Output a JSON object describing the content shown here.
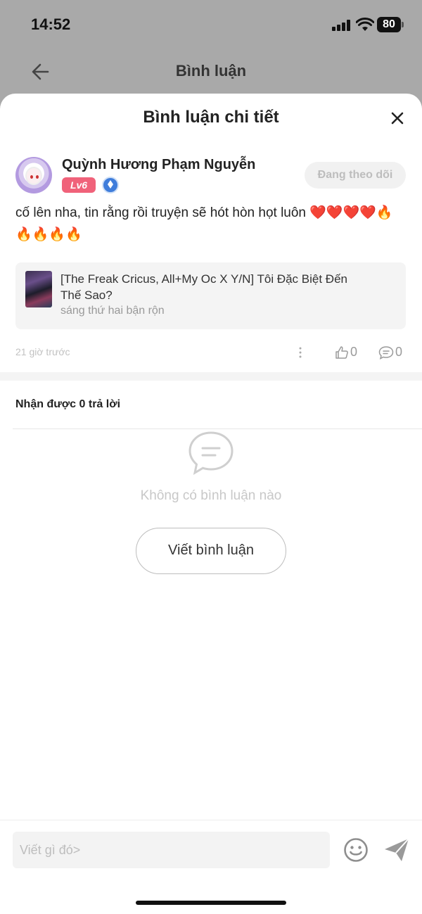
{
  "status_bar": {
    "time": "14:52",
    "battery": "80"
  },
  "nav": {
    "title": "Bình luận"
  },
  "sheet": {
    "title": "Bình luận chi tiết"
  },
  "comment": {
    "username": "Quỳnh Hương Phạm Nguyễn",
    "level": "Lv6",
    "follow_label": "Đang theo dõi",
    "text": "cố lên nha, tin rằng rồi truyện sẽ hót hòn họt luôn ❤️❤️❤️❤️🔥🔥🔥🔥🔥",
    "story_title": "[The Freak Cricus, All+My Oc X Y/N] Tôi Đặc Biệt Đến Thế Sao?",
    "story_chapter": "sáng thứ hai bận rộn",
    "time": "21 giờ trước",
    "likes": "0",
    "replies": "0"
  },
  "replies_section": {
    "label": "Nhận được 0 trả lời",
    "empty_text": "Không có bình luận nào",
    "write_button": "Viết bình luận"
  },
  "input": {
    "placeholder": "Viết gì đó>"
  },
  "colors": {
    "level_badge": "#f0627a",
    "rank_badge": "#3f7ddb"
  },
  "icons": [
    "back-arrow-icon",
    "close-icon",
    "more-icon",
    "like-icon",
    "comment-icon",
    "chat-bubble-icon",
    "emoji-icon",
    "send-icon"
  ]
}
